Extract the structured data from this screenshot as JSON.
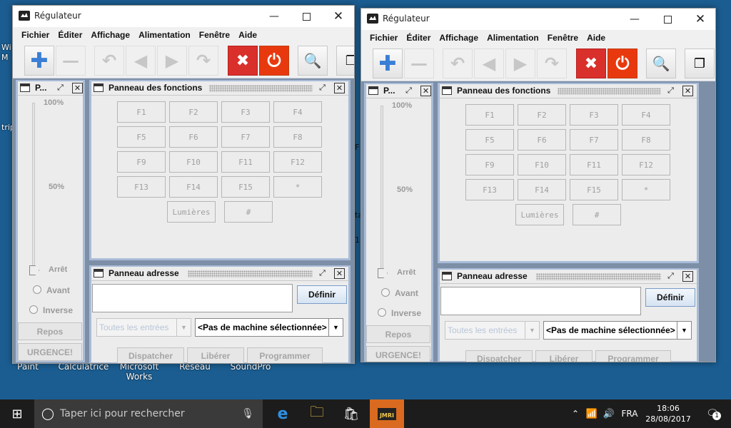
{
  "desktop": {
    "icons": [
      "Paint",
      "Calculatrice",
      "Microsoft Works",
      "Réseau",
      "SoundPro"
    ],
    "edge_fragments": [
      "Wi",
      "M",
      "trip",
      "P",
      "F",
      "P",
      "P",
      "ta",
      "1"
    ]
  },
  "windows": [
    {
      "title": "Régulateur",
      "menu": [
        "Fichier",
        "Éditer",
        "Affichage",
        "Alimentation",
        "Fenêtre",
        "Aide"
      ],
      "throttle": {
        "title": "P...",
        "tick_100": "100%",
        "tick_50": "50%",
        "stop": "Arrêt",
        "forward": "Avant",
        "reverse": "Inverse",
        "idle": "Repos",
        "emergency": "URGENCE!"
      },
      "functions": {
        "title": "Panneau des fonctions",
        "keys": [
          "F1",
          "F2",
          "F3",
          "F4",
          "F5",
          "F6",
          "F7",
          "F8",
          "F9",
          "F10",
          "F11",
          "F12",
          "F13",
          "F14",
          "F15",
          "*"
        ],
        "lights": "Lumières",
        "hash": "#"
      },
      "address": {
        "title": "Panneau adresse",
        "define": "Définir",
        "roster": "Toutes les entrées",
        "machine": "<Pas de machine sélectionnée>",
        "dispatch": "Dispatcher",
        "release": "Libérer",
        "program": "Programmer"
      }
    },
    {
      "title": "Régulateur",
      "menu": [
        "Fichier",
        "Éditer",
        "Affichage",
        "Alimentation",
        "Fenêtre",
        "Aide"
      ],
      "throttle": {
        "title": "P...",
        "tick_100": "100%",
        "tick_50": "50%",
        "stop": "Arrêt",
        "forward": "Avant",
        "reverse": "Inverse",
        "idle": "Repos",
        "emergency": "URGENCE!"
      },
      "functions": {
        "title": "Panneau des fonctions",
        "keys": [
          "F1",
          "F2",
          "F3",
          "F4",
          "F5",
          "F6",
          "F7",
          "F8",
          "F9",
          "F10",
          "F11",
          "F12",
          "F13",
          "F14",
          "F15",
          "*"
        ],
        "lights": "Lumières",
        "hash": "#"
      },
      "address": {
        "title": "Panneau adresse",
        "define": "Définir",
        "roster": "Toutes les entrées",
        "machine": "<Pas de machine sélectionnée>",
        "dispatch": "Dispatcher",
        "release": "Libérer",
        "program": "Programmer"
      }
    }
  ],
  "taskbar": {
    "search_placeholder": "Taper ici pour rechercher",
    "language": "FRA",
    "time": "18:06",
    "date": "28/08/2017",
    "notification_count": "1",
    "app_badge": "JMRI"
  },
  "colors": {
    "desktop": "#1b5d91",
    "stop_red": "#d9302b",
    "power_red": "#e8390e",
    "active_taskbar": "#d96a1f"
  }
}
